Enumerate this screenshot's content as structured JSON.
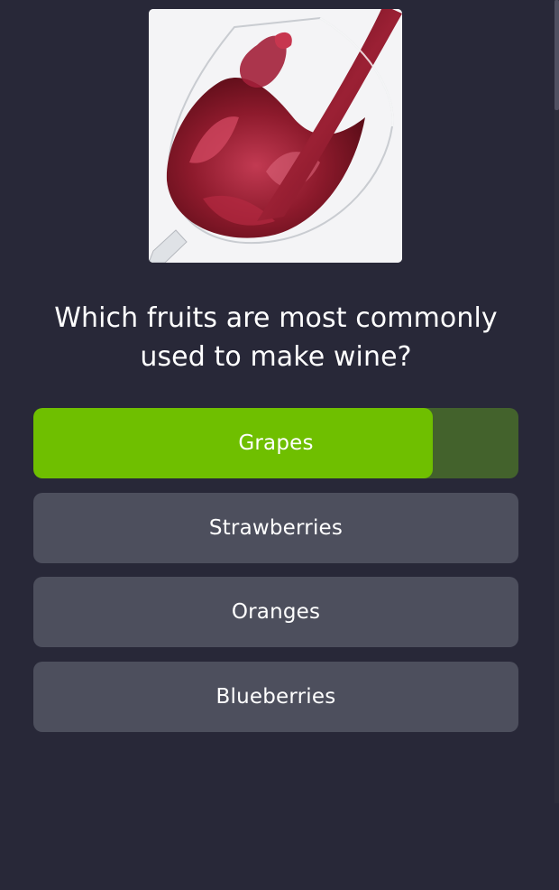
{
  "question": {
    "image_alt": "Red wine splashing in a wine glass",
    "text": "Which fruits are most commonly used to make wine?"
  },
  "answers": [
    {
      "label": "Grapes",
      "correct": true,
      "share": 0.825
    },
    {
      "label": "Strawberries",
      "correct": false
    },
    {
      "label": "Oranges",
      "correct": false
    },
    {
      "label": "Blueberries",
      "correct": false
    }
  ],
  "colors": {
    "background": "#282838",
    "correct_answer": "#6fbf00",
    "correct_answer_track": "#43622c",
    "answer_default": "#4d4f5d",
    "text": "#ffffff"
  }
}
